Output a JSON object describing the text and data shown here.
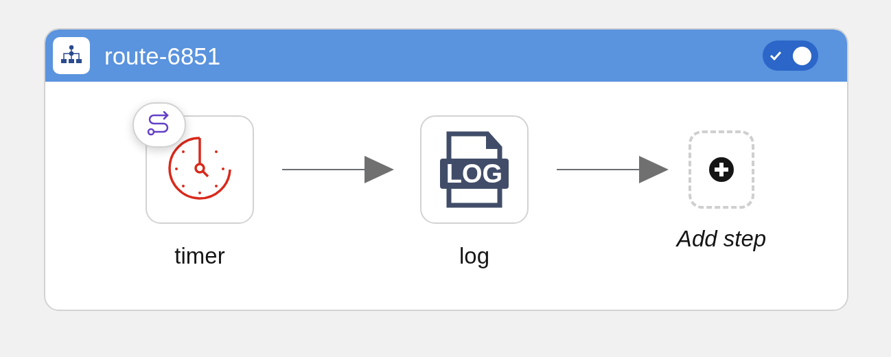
{
  "route": {
    "title": "route-6851",
    "enabled": true
  },
  "steps": [
    {
      "kind": "timer",
      "label": "timer"
    },
    {
      "kind": "log",
      "label": "log",
      "icon_text": "LOG"
    },
    {
      "kind": "add",
      "label": "Add step"
    }
  ]
}
